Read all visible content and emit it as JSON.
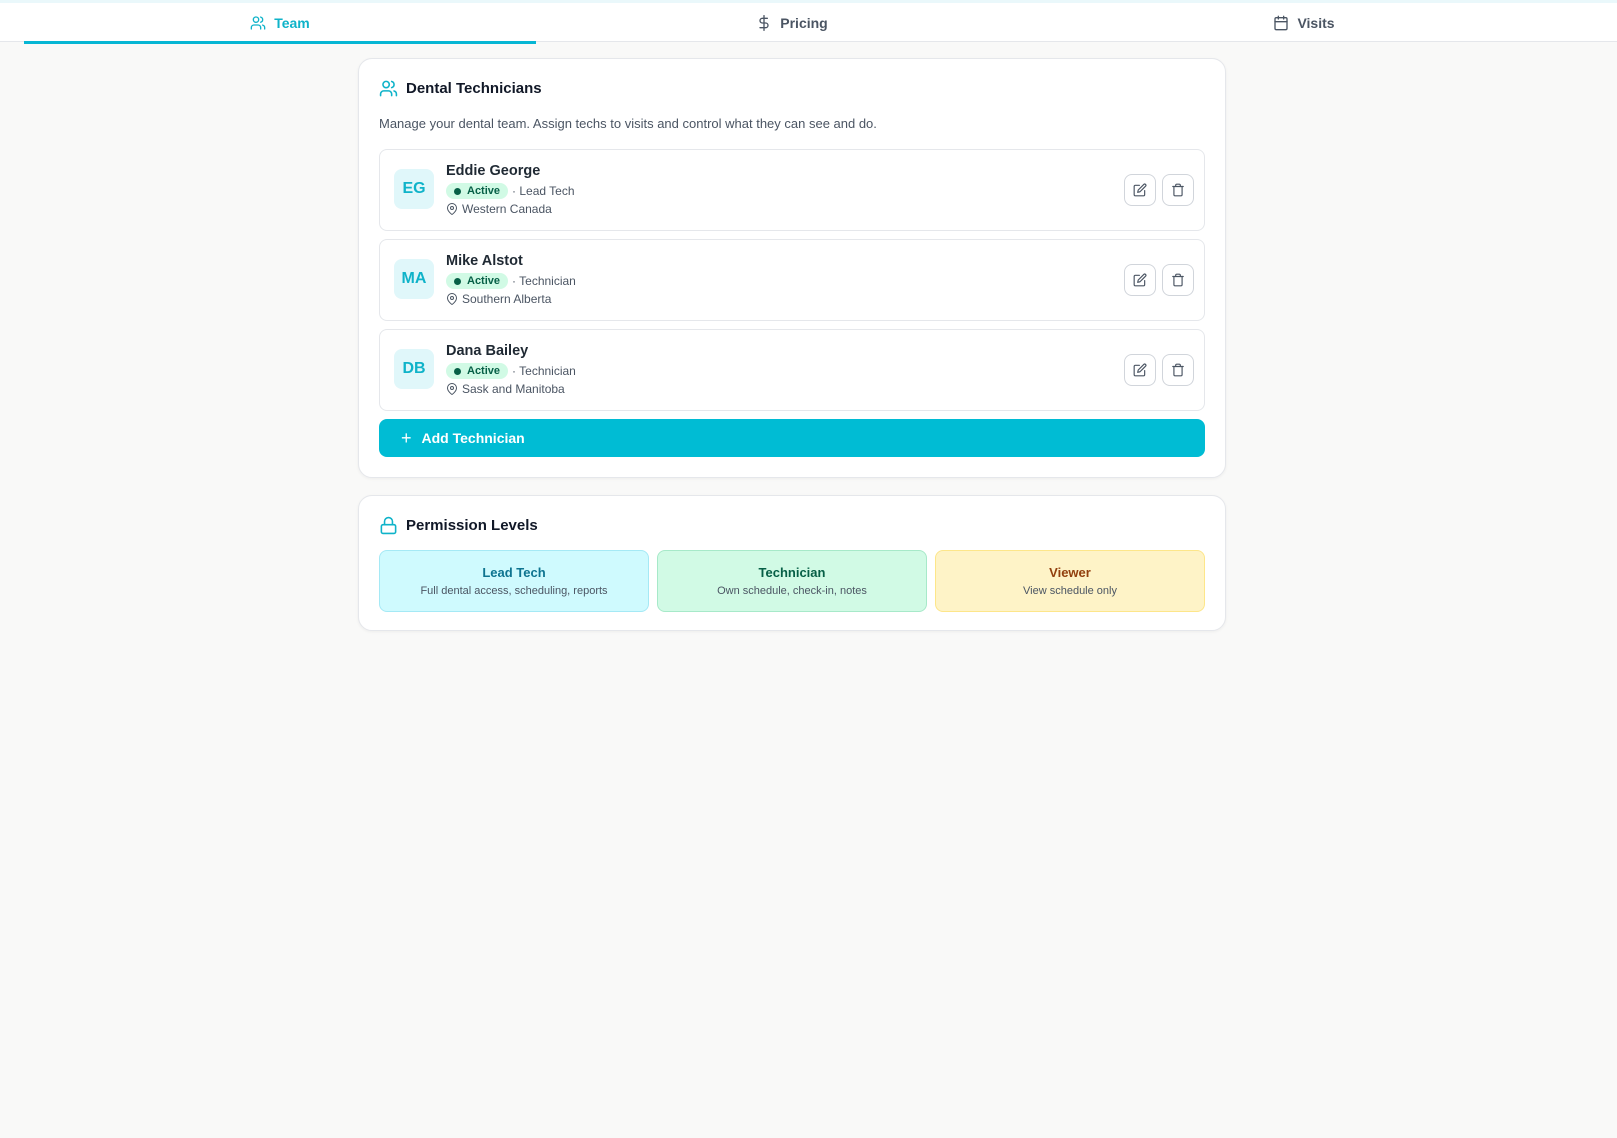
{
  "tabs": [
    {
      "label": "Team",
      "icon": "users-icon",
      "active": true
    },
    {
      "label": "Pricing",
      "icon": "dollar-icon",
      "active": false
    },
    {
      "label": "Visits",
      "icon": "calendar-icon",
      "active": false
    }
  ],
  "technicians_card": {
    "title": "Dental Technicians",
    "description": "Manage your dental team. Assign techs to visits and control what they can see and do.",
    "technicians": [
      {
        "initials": "EG",
        "name": "Eddie George",
        "status": "Active",
        "role": "· Lead Tech",
        "location": "Western Canada"
      },
      {
        "initials": "MA",
        "name": "Mike Alstot",
        "status": "Active",
        "role": "· Technician",
        "location": "Southern Alberta"
      },
      {
        "initials": "DB",
        "name": "Dana Bailey",
        "status": "Active",
        "role": "· Technician",
        "location": "Sask and Manitoba"
      }
    ],
    "add_button": "Add Technician"
  },
  "permissions_card": {
    "title": "Permission Levels",
    "levels": [
      {
        "title": "Lead Tech",
        "description": "Full dental access, scheduling, reports"
      },
      {
        "title": "Technician",
        "description": "Own schedule, check-in, notes"
      },
      {
        "title": "Viewer",
        "description": "View schedule only"
      }
    ]
  },
  "colors": {
    "accent": "#00bcd4",
    "active_badge_bg": "#d1fae5",
    "lead_tech_bg": "#cffafe",
    "technician_bg": "#d1fae5",
    "viewer_bg": "#fef3c7"
  }
}
